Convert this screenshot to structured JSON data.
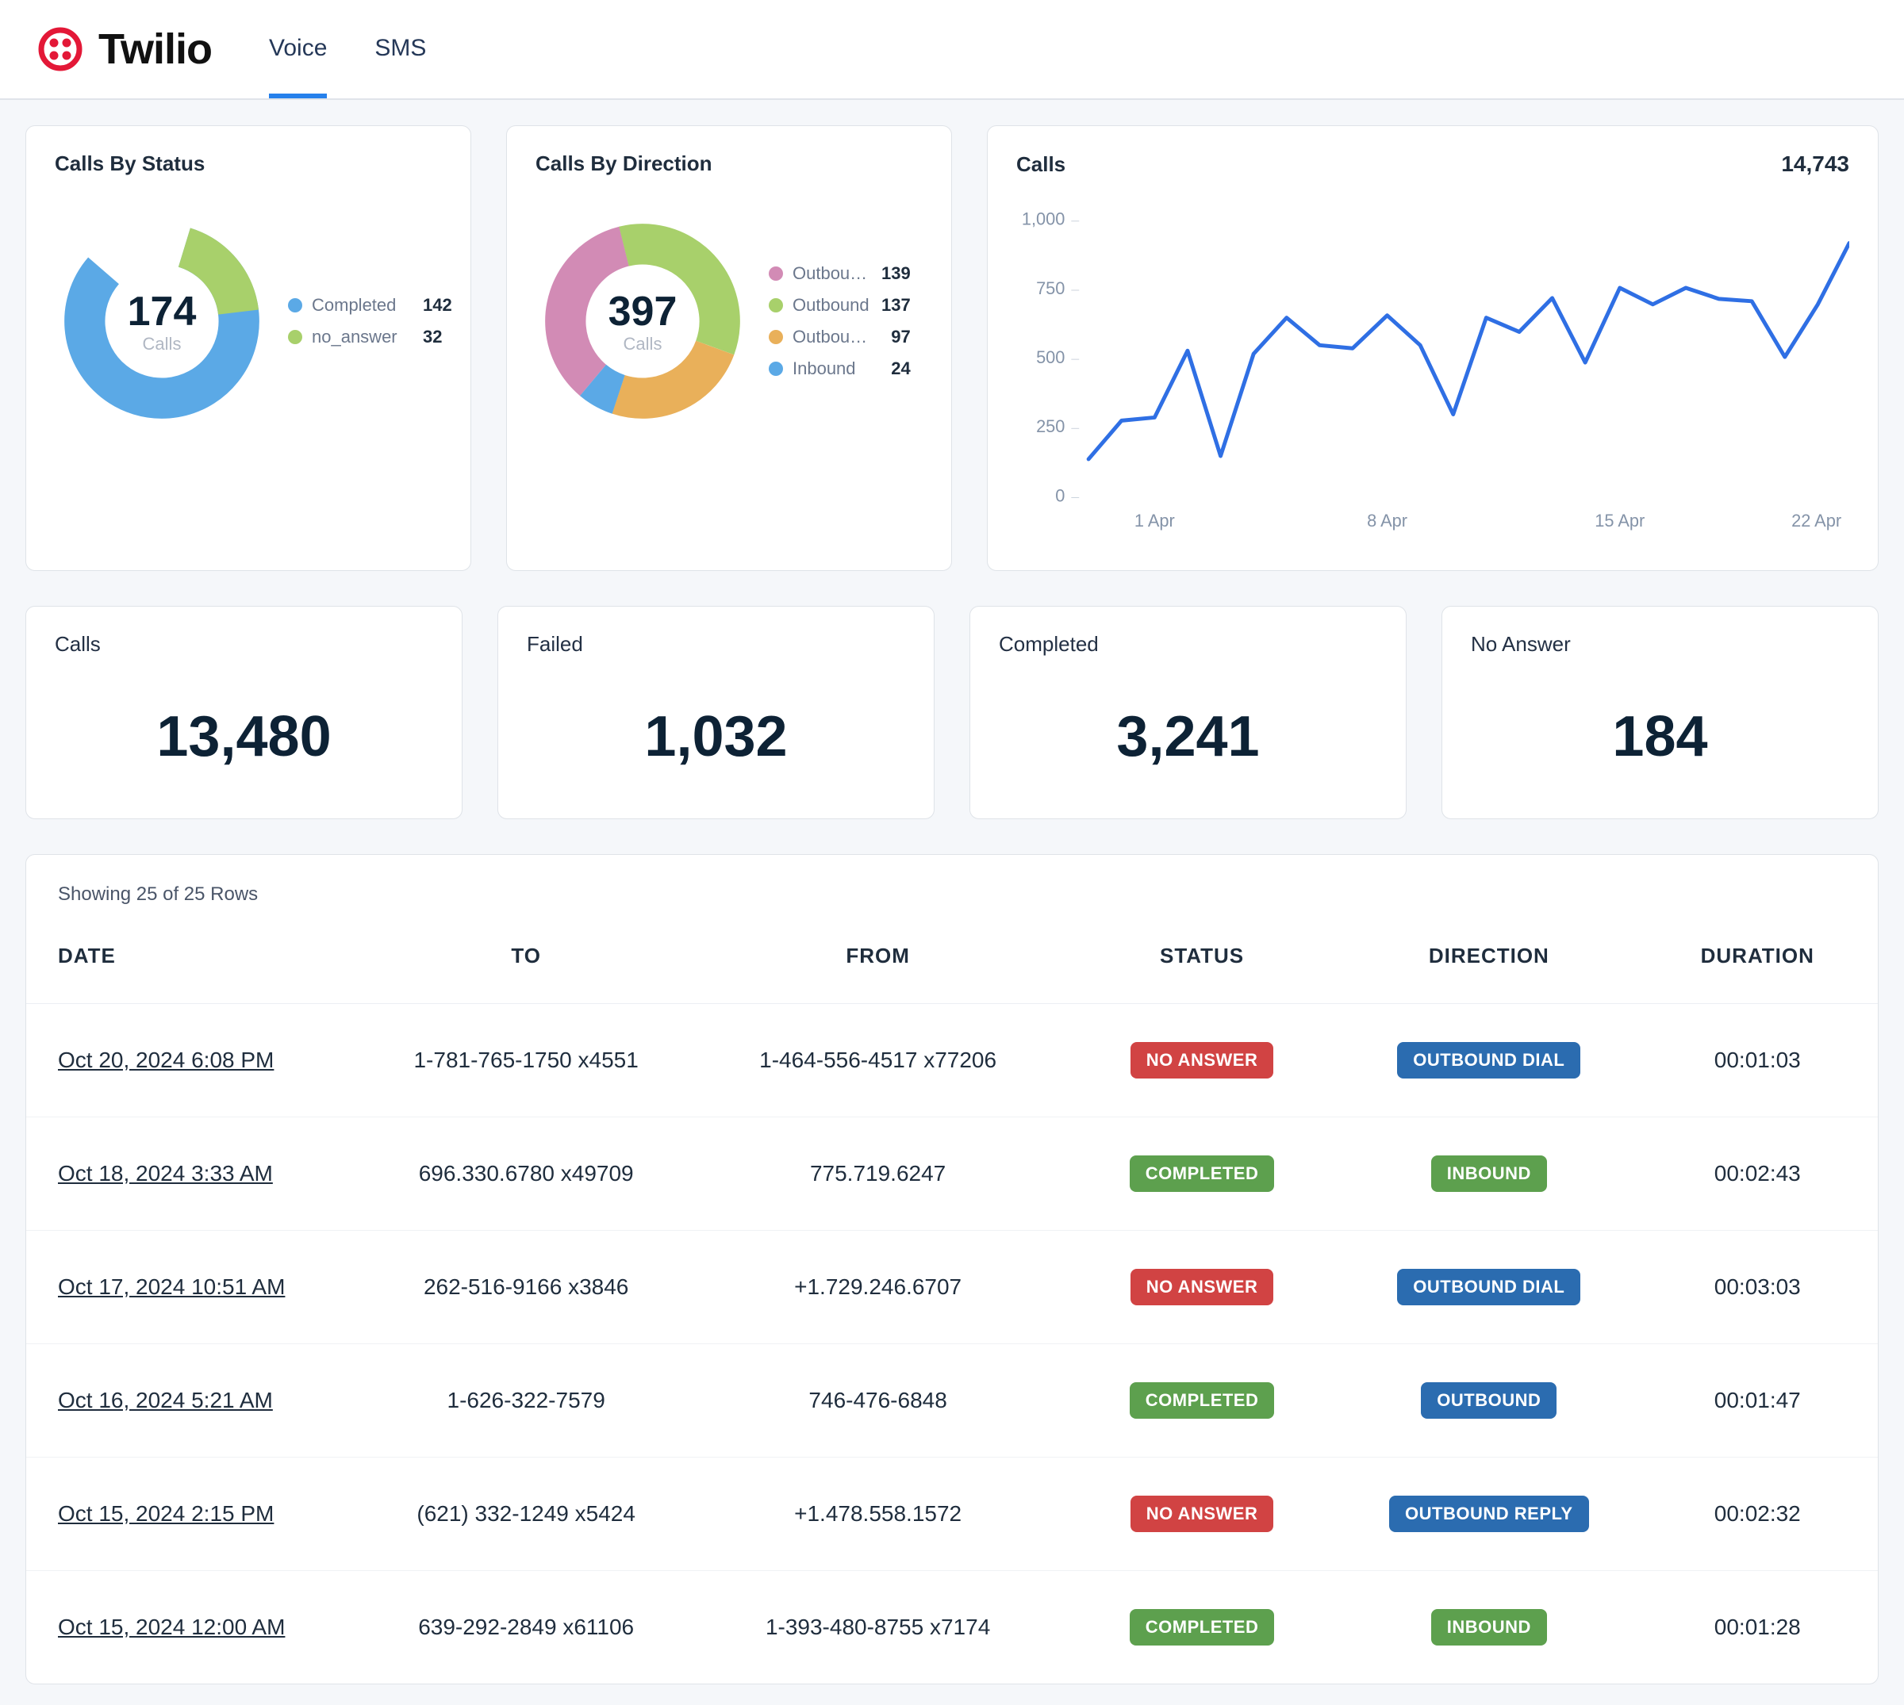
{
  "header": {
    "brand": "Twilio",
    "tabs": [
      {
        "label": "Voice",
        "active": true
      },
      {
        "label": "SMS",
        "active": false
      }
    ]
  },
  "by_status": {
    "title": "Calls By Status",
    "total": "174",
    "sub": "Calls",
    "legend": [
      {
        "label": "Completed",
        "value": "142",
        "color": "#5ba9e6"
      },
      {
        "label": "no_answer",
        "value": "32",
        "color": "#a8d06b"
      }
    ]
  },
  "by_direction": {
    "title": "Calls By Direction",
    "total": "397",
    "sub": "Calls",
    "legend": [
      {
        "label": "Outbou…",
        "value": "139",
        "color": "#d28bb5"
      },
      {
        "label": "Outbound",
        "value": "137",
        "color": "#a8d06b"
      },
      {
        "label": "Outbou…",
        "value": "97",
        "color": "#e9b05a"
      },
      {
        "label": "Inbound",
        "value": "24",
        "color": "#5ba9e6"
      }
    ]
  },
  "calls_chart": {
    "title": "Calls",
    "total": "14,743"
  },
  "metrics": [
    {
      "label": "Calls",
      "value": "13,480"
    },
    {
      "label": "Failed",
      "value": "1,032"
    },
    {
      "label": "Completed",
      "value": "3,241"
    },
    {
      "label": "No Answer",
      "value": "184"
    }
  ],
  "table": {
    "rows_info": "Showing 25 of 25 Rows",
    "columns": [
      "DATE",
      "TO",
      "FROM",
      "STATUS",
      "DIRECTION",
      "DURATION"
    ],
    "rows": [
      {
        "date": "Oct 20, 2024 6:08 PM",
        "to": "1-781-765-1750 x4551",
        "from": "1-464-556-4517 x77206",
        "status": "NO ANSWER",
        "status_cls": "red",
        "direction": "OUTBOUND DIAL",
        "dir_cls": "blue",
        "duration": "00:01:03"
      },
      {
        "date": "Oct 18, 2024 3:33 AM",
        "to": "696.330.6780 x49709",
        "from": "775.719.6247",
        "status": "COMPLETED",
        "status_cls": "green",
        "direction": "INBOUND",
        "dir_cls": "green",
        "duration": "00:02:43"
      },
      {
        "date": "Oct 17, 2024 10:51 AM",
        "to": "262-516-9166 x3846",
        "from": "+1.729.246.6707",
        "status": "NO ANSWER",
        "status_cls": "red",
        "direction": "OUTBOUND DIAL",
        "dir_cls": "blue",
        "duration": "00:03:03"
      },
      {
        "date": "Oct 16, 2024 5:21 AM",
        "to": "1-626-322-7579",
        "from": "746-476-6848",
        "status": "COMPLETED",
        "status_cls": "green",
        "direction": "OUTBOUND",
        "dir_cls": "blue",
        "duration": "00:01:47"
      },
      {
        "date": "Oct 15, 2024 2:15 PM",
        "to": "(621) 332-1249 x5424",
        "from": "+1.478.558.1572",
        "status": "NO ANSWER",
        "status_cls": "red",
        "direction": "OUTBOUND REPLY",
        "dir_cls": "blue",
        "duration": "00:02:32"
      },
      {
        "date": "Oct 15, 2024 12:00 AM",
        "to": "639-292-2849 x61106",
        "from": "1-393-480-8755 x7174",
        "status": "COMPLETED",
        "status_cls": "green",
        "direction": "INBOUND",
        "dir_cls": "green",
        "duration": "00:01:28"
      }
    ]
  },
  "chart_data": [
    {
      "type": "pie",
      "title": "Calls By Status",
      "categories": [
        "Completed",
        "no_answer"
      ],
      "values": [
        142,
        32
      ],
      "total": 174
    },
    {
      "type": "pie",
      "title": "Calls By Direction",
      "categories": [
        "Outbound (dial)",
        "Outbound",
        "Outbound (reply)",
        "Inbound"
      ],
      "values": [
        139,
        137,
        97,
        24
      ],
      "total": 397
    },
    {
      "type": "line",
      "title": "Calls",
      "total": 14743,
      "xlabel": "",
      "ylabel": "",
      "ylim": [
        0,
        1000
      ],
      "y_ticks": [
        0,
        250,
        500,
        750,
        1000
      ],
      "x_ticks": [
        "1 Apr",
        "8 Apr",
        "15 Apr",
        "22 Apr"
      ],
      "x": [
        "Mar 30",
        "Mar 31",
        "Apr 1",
        "Apr 2",
        "Apr 3",
        "Apr 4",
        "Apr 5",
        "Apr 6",
        "Apr 7",
        "Apr 8",
        "Apr 9",
        "Apr 10",
        "Apr 11",
        "Apr 12",
        "Apr 13",
        "Apr 14",
        "Apr 15",
        "Apr 16",
        "Apr 17",
        "Apr 18",
        "Apr 19",
        "Apr 20",
        "Apr 21",
        "Apr 22"
      ],
      "series": [
        {
          "name": "Calls",
          "values": [
            140,
            280,
            290,
            530,
            150,
            520,
            650,
            550,
            540,
            660,
            550,
            300,
            650,
            600,
            720,
            490,
            760,
            700,
            760,
            720,
            710,
            510,
            700,
            920
          ]
        }
      ]
    }
  ]
}
